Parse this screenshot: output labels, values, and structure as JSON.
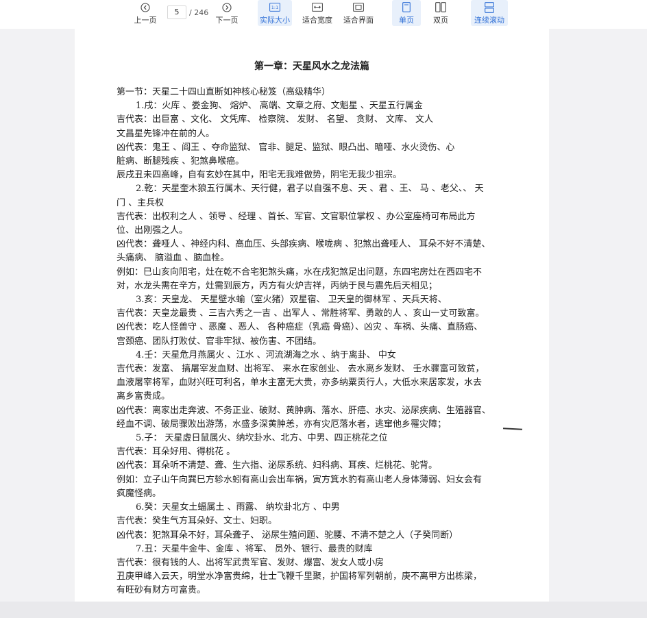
{
  "toolbar": {
    "prev_label": "上一页",
    "next_label": "下一页",
    "current_page": "5",
    "total_pages": "/ 246",
    "actual_size_label": "实际大小",
    "fit_width_label": "适合宽度",
    "fit_page_label": "适合界面",
    "single_label": "单页",
    "double_label": "双页",
    "continuous_label": "连续滚动",
    "actual_size_icon_text": "1:1"
  },
  "document": {
    "title": "第一章：天星风水之龙法篇",
    "lines": [
      "第一节：天星二十四山直断如神核心秘笈（高级精华）",
      "1.戌：火库 、娄金狗、 熔炉、 高端、文章之府、文魁星 、天星五行属金",
      "吉代表：出巨富 、文化、 文凭库、 检察院、 发财、 名望、 贪财、 文库、 文人",
      "文昌星先锋冲在前的人。",
      "凶代表：鬼王 、阎王 、夺命监狱、 官非、腿足、监狱、眼凸出、暗哑、水火烫伤、心",
      "脏病、断腿残疾 、犯煞鼻喉癌。",
      "辰戌丑未四高峰，自有玄妙在其中，阳宅无我难做势，阴宅无我少祖宗。",
      "2.乾：天星奎木狼五行属木、天行健，君子以自强不息、天 、君 、王、 马 、老父、、 天",
      "门 、主兵权",
      "吉代表：出权利之人 、领导 、经理 、首长、军官、文官职位掌权 、办公室座椅可布局此方",
      "位、出刚强之人。",
      "凶代表：聋哑人 、神经内科、高血压、头部疾病、喉咙病 、犯煞出聋哑人、 耳朵不好不清楚、",
      "头痛病、 脑溢血 、脑血栓。",
      "例如：巳山亥向阳宅，灶在乾不合宅犯煞头痛，水在戌犯煞足出问题，东四宅房灶在西四宅不",
      "对，水龙头需在辛方，灶需到辰方，丙方有火炉吉祥，丙纳于艮与震先后天相见；",
      "3.亥：天皇龙、 天星壁水蝓（室火猪）双星宿、 卫天皇的御林军 、天兵天将、",
      "吉代表：天皇龙最贵 、三吉六秀之一吉 、出军人 、常胜将军、勇敢的人 、亥山一丈可致富。",
      "凶代表：吃人怪兽守 、恶魔 、恶人、 各种癌症（乳癌 骨癌）、凶灾 、车祸、头痛、直肠癌、",
      "宫颈癌、团队打败仗、官非牢狱、被伤害、不团结。",
      "4.壬：天星危月燕属火 、江水 、河流湖海之水 、纳于离卦、 中女",
      "吉代表：发富、 搞屠宰发血财、出将军、 来水在家创业、 去水离乡发财、 壬水骤富可致贫，",
      "血液屠宰将军，血财兴旺可利名，单水主富无大贵，亦多纳粟贡行人，大低水来居家发，水去",
      "离乡富贵成。",
      "凶代表：离家出走奔波、不务正业、破财、黄肿病、落水、肝癌、水灾、泌尿疾病、生殖器官、",
      "经血不调、破局骤败出游荡，水盛多深黄肿恙，亦有灾厄落水者，逃窜他乡罹灾障；",
      "5.子： 天星虚日鼠属火、纳坎卦水、北方、中男、四正桃花之位",
      "吉代表：耳朵好用、得桃花 。",
      "凶代表：耳朵听不清楚、聋、生六指、泌尿系统、妇科病、耳疾、烂桃花、驼背。",
      "例如：立子山午向巽巳方轸水蚓有高山会出车祸，寅方箕水豹有高山老人身体薄弱、妇女会有",
      "疯魔怪病。",
      "6.癸：天星女土蝠属土 、雨露、 纳坎卦北方 、中男",
      "吉代表：癸生气方耳朵好、文士、妇职。",
      "凶代表：犯煞耳朵不好，耳朵聋子、 泌尿生殖问题、驼腰、不清不楚之人（子癸同断）",
      "7.丑：天星牛金牛、金库 、将军、 员外、银行、最贵的财库",
      "吉代表：很有钱的人、出将军武贵军官、发财、爆富、发女人或小房",
      "丑庚甲峰入云天，明堂水净富贵绵，壮士飞鞭千里聚，护国将军列朝前，庚不离甲方出栋梁，",
      "有旺砂有财方可富贵。"
    ]
  }
}
